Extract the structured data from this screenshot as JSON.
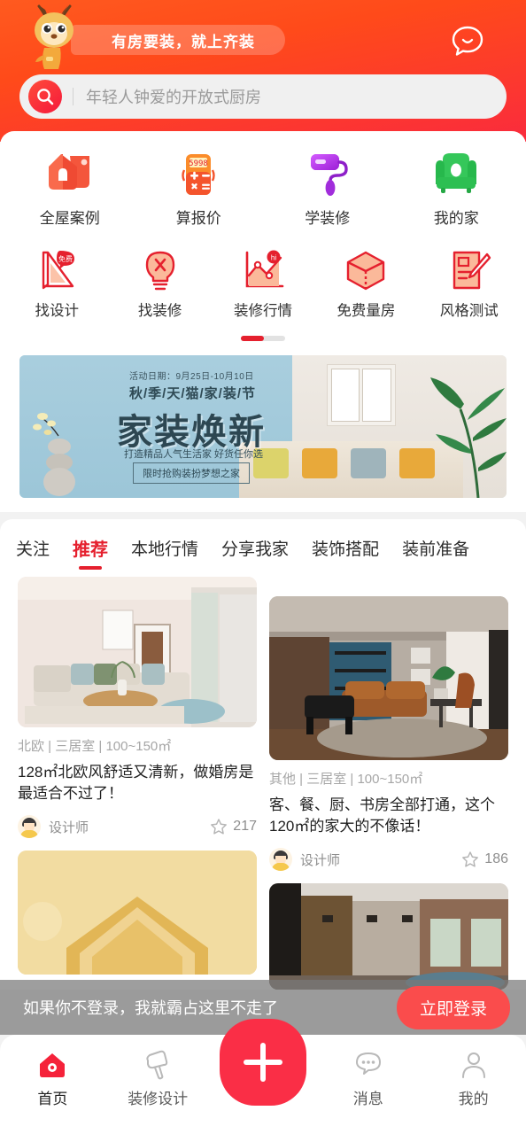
{
  "header": {
    "slogan": "有房要装，就上齐装",
    "chat_icon": "smiley-chat-icon",
    "search": {
      "icon": "search-icon",
      "placeholder": "年轻人钟爱的开放式厨房",
      "value": ""
    }
  },
  "quick_grid_primary": [
    {
      "label": "全屋案例",
      "icon": "house-tag-icon",
      "color": "#f4563c"
    },
    {
      "label": "算报价",
      "icon": "calculator-icon",
      "color": "#f7912a"
    },
    {
      "label": "学装修",
      "icon": "paint-roller-icon",
      "color": "#a02ee0"
    },
    {
      "label": "我的家",
      "icon": "sofa-icon",
      "color": "#34c759"
    }
  ],
  "quick_grid_secondary": [
    {
      "label": "找设计",
      "icon": "ruler-design-icon",
      "badge": "免费"
    },
    {
      "label": "找装修",
      "icon": "lightbulb-icon",
      "badge": ""
    },
    {
      "label": "装修行情",
      "icon": "trend-chart-icon",
      "badge": "hi"
    },
    {
      "label": "免费量房",
      "icon": "cube-measure-icon",
      "badge": ""
    },
    {
      "label": "风格测试",
      "icon": "clipboard-pen-icon",
      "badge": ""
    }
  ],
  "pager": {
    "current": 1,
    "total": 2
  },
  "banner": {
    "date": "活动日期：9月25日-10月10日",
    "subtitle": "秋/季/天/猫/家/装/节",
    "title": "家装焕新",
    "desc": "打造精品人气生活家 好货任你选",
    "button": "限时抢购装扮梦想之家"
  },
  "feed": {
    "tabs": [
      {
        "label": "关注",
        "active": false
      },
      {
        "label": "推荐",
        "active": true
      },
      {
        "label": "本地行情",
        "active": false
      },
      {
        "label": "分享我家",
        "active": false
      },
      {
        "label": "装饰搭配",
        "active": false
      },
      {
        "label": "装前准备",
        "active": false
      }
    ],
    "cards_left": [
      {
        "meta": "北欧 | 三居室 | 100~150㎡",
        "title": "128㎡北欧风舒适又清新，做婚房是最适合不过了！",
        "author": "设计师",
        "likes": "217",
        "like_icon": "star-outline-icon"
      },
      {
        "meta": "",
        "title": "",
        "author": "",
        "likes": "",
        "like_icon": "star-outline-icon"
      }
    ],
    "cards_right": [
      {
        "meta": "其他 | 三居室 | 100~150㎡",
        "title": "客、餐、厨、书房全部打通，这个120㎡的家大的不像话！",
        "author": "设计师",
        "likes": "186",
        "like_icon": "star-outline-icon"
      },
      {
        "meta": "",
        "title": "",
        "author": "",
        "likes": "",
        "like_icon": "star-outline-icon"
      }
    ]
  },
  "login_bar": {
    "message": "如果你不登录，我就霸占这里不走了",
    "button": "立即登录",
    "button_color": "#fa4c4c"
  },
  "bottom_nav": {
    "items": [
      {
        "label": "首页",
        "icon": "home-icon",
        "active": true
      },
      {
        "label": "装修设计",
        "icon": "paint-roller-outline-icon",
        "active": false
      },
      {
        "label": "消息",
        "icon": "chat-dots-icon",
        "active": false
      },
      {
        "label": "我的",
        "icon": "person-icon",
        "active": false
      }
    ],
    "fab": {
      "icon": "plus-icon",
      "color": "#fa2e46"
    }
  },
  "colors": {
    "brand_red": "#e5202e",
    "header_gradient_start": "#ff5a1f",
    "header_gradient_end": "#fa2b3d",
    "fab_red": "#fa2e46"
  }
}
